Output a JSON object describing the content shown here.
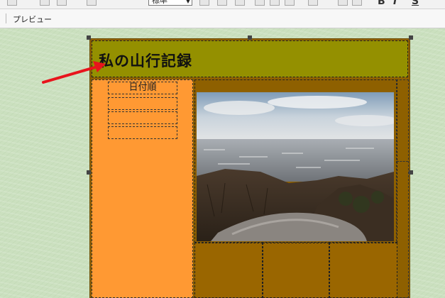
{
  "toolbar": {
    "style_select": "標準",
    "bold_label": "B",
    "italic_label": "I",
    "underline_label": "S"
  },
  "previewbar": {
    "preview_label": "プレビュー"
  },
  "page": {
    "title": "私の山行記録",
    "sidebar_items": [
      "日付順",
      "",
      "",
      ""
    ]
  },
  "colors": {
    "header_bg": "#949000",
    "sidebar_bg": "#ff9933",
    "content_bg": "#9a6600",
    "canvas_bg": "#cbe0bf",
    "arrow": "#e8141c"
  },
  "icons": [
    "table-icon",
    "undo-icon",
    "redo-icon",
    "bullets-icon"
  ]
}
